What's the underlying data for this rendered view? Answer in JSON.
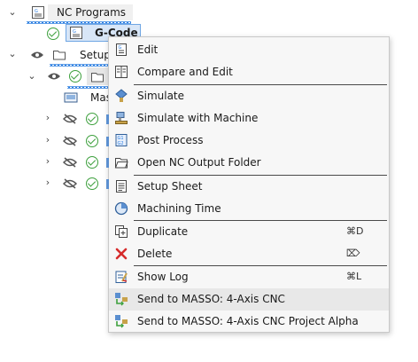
{
  "tree": {
    "nc_programs_label": "NC Programs",
    "gcode_label": "G-Code",
    "setup_label": "Setup",
    "masso_label": "Mas"
  },
  "menu": {
    "items": [
      {
        "label": "Edit",
        "icon": "edit-doc-icon",
        "shortcut": ""
      },
      {
        "label": "Compare and Edit",
        "icon": "compare-icon",
        "shortcut": ""
      },
      {
        "label": "Simulate",
        "icon": "simulate-icon",
        "shortcut": ""
      },
      {
        "label": "Simulate with Machine",
        "icon": "simulate-machine-icon",
        "shortcut": ""
      },
      {
        "label": "Post Process",
        "icon": "post-process-icon",
        "shortcut": ""
      },
      {
        "label": "Open NC Output Folder",
        "icon": "folder-icon",
        "shortcut": ""
      },
      {
        "label": "Setup Sheet",
        "icon": "setup-sheet-icon",
        "shortcut": ""
      },
      {
        "label": "Machining Time",
        "icon": "clock-icon",
        "shortcut": ""
      },
      {
        "label": "Duplicate",
        "icon": "duplicate-icon",
        "shortcut": "⌘D"
      },
      {
        "label": "Delete",
        "icon": "delete-x-icon",
        "shortcut": "⌦"
      },
      {
        "label": "Show Log",
        "icon": "log-icon",
        "shortcut": "⌘L"
      },
      {
        "label": "Send to MASSO: 4-Axis CNC",
        "icon": "send-masso-icon",
        "shortcut": ""
      },
      {
        "label": "Send to MASSO: 4-Axis CNC Project Alpha",
        "icon": "send-masso-icon",
        "shortcut": ""
      }
    ],
    "highlighted_index": 11
  },
  "colors": {
    "accent_blue": "#2a7de1",
    "check_green": "#3da03d",
    "delete_red": "#d62b2b"
  }
}
